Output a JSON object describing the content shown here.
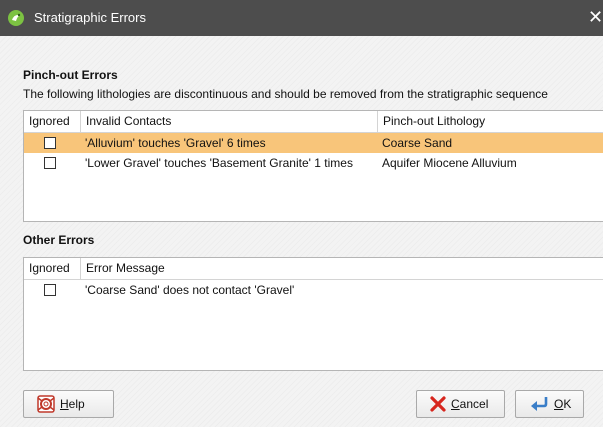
{
  "window": {
    "title": "Stratigraphic Errors",
    "close_glyph": "✕"
  },
  "pinchout": {
    "section_title": "Pinch-out Errors",
    "description": "The following lithologies are discontinuous and should be removed from the stratigraphic sequence",
    "columns": [
      "Ignored",
      "Invalid Contacts",
      "Pinch-out Lithology"
    ],
    "rows": [
      {
        "ignored": false,
        "contact": "'Alluvium' touches 'Gravel' 6 times",
        "lithology": "Coarse Sand",
        "selected": true
      },
      {
        "ignored": false,
        "contact": "'Lower Gravel' touches 'Basement Granite' 1 times",
        "lithology": "Aquifer Miocene Alluvium",
        "selected": false
      }
    ]
  },
  "other": {
    "section_title": "Other Errors",
    "columns": [
      "Ignored",
      "Error Message"
    ],
    "rows": [
      {
        "ignored": false,
        "message": "'Coarse Sand' does not contact 'Gravel'"
      }
    ]
  },
  "buttons": {
    "help": {
      "mnemonic": "H",
      "rest": "elp",
      "icon": "lifebuoy-icon"
    },
    "cancel": {
      "mnemonic": "C",
      "rest": "ancel",
      "icon": "cancel-x-icon"
    },
    "ok": {
      "mnemonic": "O",
      "rest": "K",
      "icon": "return-arrow-icon"
    }
  },
  "colors": {
    "titlebar": "#4d4d4d",
    "selection": "#f8c57a",
    "app_icon": "#7cc242"
  }
}
